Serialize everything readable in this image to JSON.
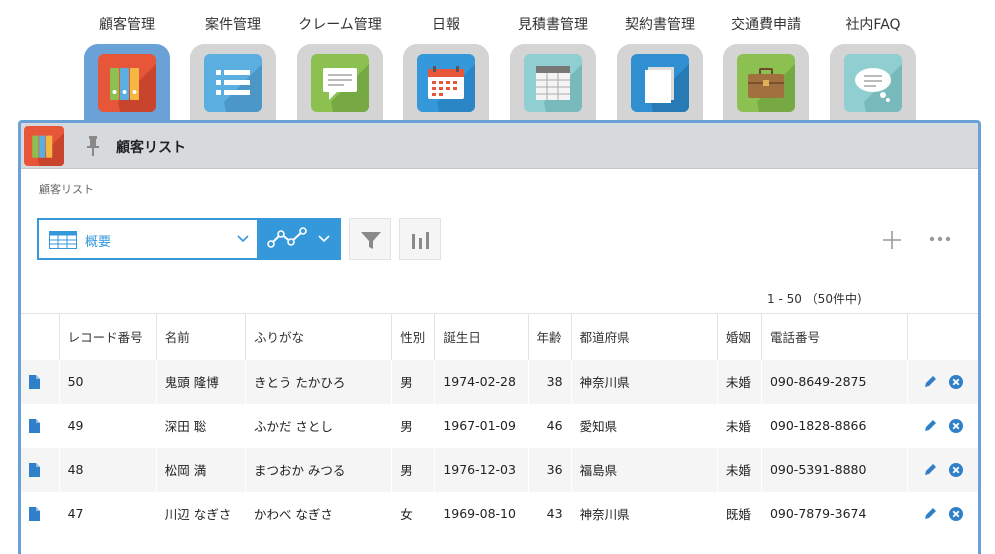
{
  "apps": [
    {
      "label": "顧客管理",
      "icon": "binders-icon",
      "color": "#e8563a",
      "active": true
    },
    {
      "label": "案件管理",
      "icon": "list-icon",
      "color": "#5aaee0"
    },
    {
      "label": "クレーム管理",
      "icon": "speech-bubble-icon",
      "color": "#8cc152"
    },
    {
      "label": "日報",
      "icon": "calendar-icon",
      "color": "#3498db"
    },
    {
      "label": "見積書管理",
      "icon": "calculator-sheet-icon",
      "color": "#8fcfd1"
    },
    {
      "label": "契約書管理",
      "icon": "documents-icon",
      "color": "#2f8fd0"
    },
    {
      "label": "交通費申請",
      "icon": "briefcase-icon",
      "color": "#8cc152"
    },
    {
      "label": "社内FAQ",
      "icon": "thought-bubble-icon",
      "color": "#8fcfd1"
    }
  ],
  "window": {
    "title": "顧客リスト",
    "breadcrumb": "顧客リスト",
    "view_label": "概要",
    "record_count": "1 - 50 （50件中)"
  },
  "table": {
    "headers": [
      "",
      "レコード番号",
      "名前",
      "ふりがな",
      "性別",
      "誕生日",
      "年齢",
      "都道府県",
      "婚姻",
      "電話番号",
      ""
    ],
    "rows": [
      {
        "id": "50",
        "name": "鬼頭 隆博",
        "kana": "きとう たかひろ",
        "sex": "男",
        "birth": "1974-02-28",
        "age": "38",
        "pref": "神奈川県",
        "marital": "未婚",
        "phone": "090-8649-2875"
      },
      {
        "id": "49",
        "name": "深田 聡",
        "kana": "ふかだ さとし",
        "sex": "男",
        "birth": "1967-01-09",
        "age": "46",
        "pref": "愛知県",
        "marital": "未婚",
        "phone": "090-1828-8866"
      },
      {
        "id": "48",
        "name": "松岡 満",
        "kana": "まつおか みつる",
        "sex": "男",
        "birth": "1976-12-03",
        "age": "36",
        "pref": "福島県",
        "marital": "未婚",
        "phone": "090-5391-8880"
      },
      {
        "id": "47",
        "name": "川辺 なぎさ",
        "kana": "かわべ なぎさ",
        "sex": "女",
        "birth": "1969-08-10",
        "age": "43",
        "pref": "神奈川県",
        "marital": "既婚",
        "phone": "090-7879-3674"
      }
    ]
  },
  "colors": {
    "accent": "#3498db",
    "active_tab": "#6aa2d8",
    "edit": "#2f80c8",
    "delete": "#2f80c8"
  }
}
